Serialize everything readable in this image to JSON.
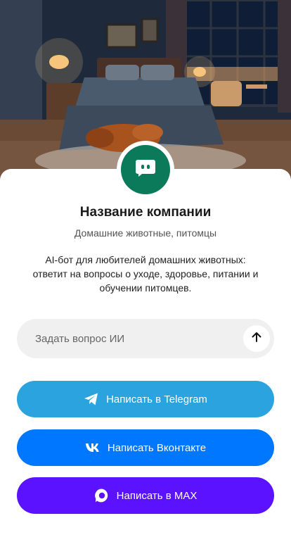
{
  "company": {
    "name": "Название компании",
    "category": "Домашние животные, питомцы",
    "description": "AI-бот для любителей домашних животных: ответит на вопросы о уходе, здоровье, питании и обучении питомцев."
  },
  "ask": {
    "placeholder": "Задать вопрос ИИ"
  },
  "buttons": {
    "telegram": "Написать в Telegram",
    "vk": "Написать Вконтакте",
    "max": "Написать в MAX"
  },
  "icons": {
    "avatar": "chat-bot-icon",
    "send": "arrow-up-icon",
    "telegram": "telegram-icon",
    "vk": "vk-icon",
    "max": "max-icon"
  },
  "colors": {
    "avatar": "#0b7a5a",
    "telegram": "#2aa3df",
    "vk": "#0077ff",
    "max": "#5a12ff",
    "input_bg": "#f0f0f0"
  }
}
